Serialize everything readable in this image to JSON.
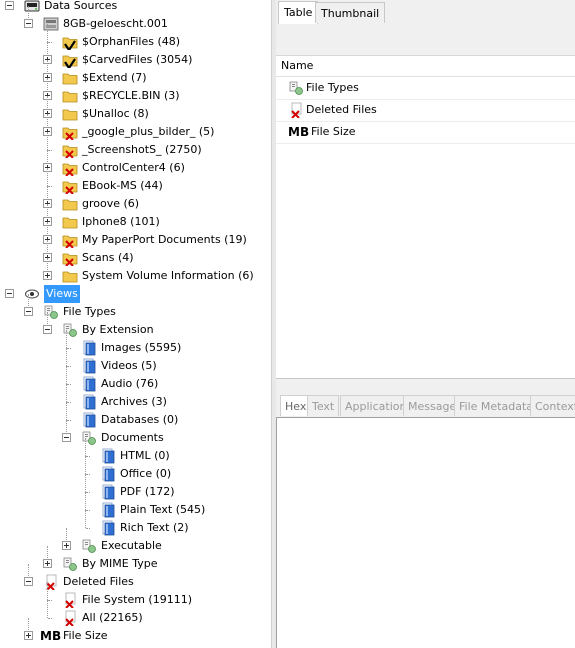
{
  "tree": [
    {
      "label": "Data Sources",
      "level": 0,
      "icon": "drive-icon",
      "toggle": "minus",
      "name": "data-sources"
    },
    {
      "label": "8GB-geloescht.001",
      "level": 1,
      "icon": "disk-image-icon",
      "toggle": "minus",
      "name": "image-8gb"
    },
    {
      "label": "$OrphanFiles (48)",
      "level": 2,
      "icon": "folder-checked-icon",
      "toggle": null,
      "name": "orphan-files"
    },
    {
      "label": "$CarvedFiles (3054)",
      "level": 2,
      "icon": "folder-checked-icon",
      "toggle": "plus",
      "name": "carved-files"
    },
    {
      "label": "$Extend (7)",
      "level": 2,
      "icon": "folder-icon",
      "toggle": "plus",
      "name": "extend"
    },
    {
      "label": "$RECYCLE.BIN (3)",
      "level": 2,
      "icon": "folder-icon",
      "toggle": "plus",
      "name": "recycle-bin"
    },
    {
      "label": "$Unalloc (8)",
      "level": 2,
      "icon": "folder-icon",
      "toggle": "plus",
      "name": "unalloc"
    },
    {
      "label": "_google_plus_bilder_ (5)",
      "level": 2,
      "icon": "folder-deleted-icon",
      "toggle": "plus",
      "name": "google-plus-bilder"
    },
    {
      "label": "_ScreenshotS_ (2750)",
      "level": 2,
      "icon": "folder-deleted-icon",
      "toggle": null,
      "name": "screenshots"
    },
    {
      "label": "ControlCenter4 (6)",
      "level": 2,
      "icon": "folder-deleted-icon",
      "toggle": "plus",
      "name": "controlcenter4"
    },
    {
      "label": "EBook-MS (44)",
      "level": 2,
      "icon": "folder-deleted-icon",
      "toggle": null,
      "name": "ebook-ms"
    },
    {
      "label": "groove (6)",
      "level": 2,
      "icon": "folder-icon",
      "toggle": "plus",
      "name": "groove"
    },
    {
      "label": "Iphone8 (101)",
      "level": 2,
      "icon": "folder-icon",
      "toggle": "plus",
      "name": "iphone8"
    },
    {
      "label": "My PaperPort Documents (19)",
      "level": 2,
      "icon": "folder-deleted-icon",
      "toggle": "plus",
      "name": "paperport"
    },
    {
      "label": "Scans (4)",
      "level": 2,
      "icon": "folder-deleted-icon",
      "toggle": "plus",
      "name": "scans"
    },
    {
      "label": "System Volume Information (6)",
      "level": 2,
      "icon": "folder-icon",
      "toggle": "plus",
      "name": "system-volume-information"
    },
    {
      "label": "Views",
      "level": 0,
      "icon": "eye-icon",
      "toggle": "minus",
      "name": "views",
      "selected": true
    },
    {
      "label": "File Types",
      "level": 1,
      "icon": "file-types-icon",
      "toggle": "minus",
      "name": "file-types"
    },
    {
      "label": "By Extension",
      "level": 2,
      "icon": "file-types-icon",
      "toggle": "minus",
      "name": "by-extension"
    },
    {
      "label": "Images (5595)",
      "level": 3,
      "icon": "document-icon",
      "toggle": null,
      "name": "images"
    },
    {
      "label": "Videos (5)",
      "level": 3,
      "icon": "document-icon",
      "toggle": null,
      "name": "videos"
    },
    {
      "label": "Audio (76)",
      "level": 3,
      "icon": "document-icon",
      "toggle": null,
      "name": "audio"
    },
    {
      "label": "Archives (3)",
      "level": 3,
      "icon": "document-icon",
      "toggle": null,
      "name": "archives"
    },
    {
      "label": "Databases (0)",
      "level": 3,
      "icon": "document-icon",
      "toggle": null,
      "name": "databases"
    },
    {
      "label": "Documents",
      "level": 3,
      "icon": "file-types-icon",
      "toggle": "minus",
      "name": "documents"
    },
    {
      "label": "HTML (0)",
      "level": 4,
      "icon": "document-icon",
      "toggle": null,
      "name": "html"
    },
    {
      "label": "Office (0)",
      "level": 4,
      "icon": "document-icon",
      "toggle": null,
      "name": "office"
    },
    {
      "label": "PDF (172)",
      "level": 4,
      "icon": "document-icon",
      "toggle": null,
      "name": "pdf"
    },
    {
      "label": "Plain Text (545)",
      "level": 4,
      "icon": "document-icon",
      "toggle": null,
      "name": "plain-text"
    },
    {
      "label": "Rich Text (2)",
      "level": 4,
      "icon": "document-icon",
      "toggle": null,
      "name": "rich-text"
    },
    {
      "label": "Executable",
      "level": 3,
      "icon": "file-types-icon",
      "toggle": "plus",
      "name": "executable"
    },
    {
      "label": "By MIME Type",
      "level": 2,
      "icon": "file-types-icon",
      "toggle": "plus",
      "name": "by-mime-type"
    },
    {
      "label": "Deleted Files",
      "level": 1,
      "icon": "deleted-file-icon",
      "toggle": "minus",
      "name": "deleted-files"
    },
    {
      "label": "File System (19111)",
      "level": 2,
      "icon": "deleted-file-icon",
      "toggle": null,
      "name": "file-system"
    },
    {
      "label": "All (22165)",
      "level": 2,
      "icon": "deleted-file-icon",
      "toggle": null,
      "name": "all"
    },
    {
      "label": "File Size",
      "level": 1,
      "icon": "mb-icon",
      "toggle": "plus",
      "name": "file-size"
    }
  ],
  "results": {
    "tabs": [
      "Table",
      "Thumbnail"
    ],
    "active_tab": 0,
    "column_header": "Name",
    "rows": [
      {
        "label": "File Types",
        "icon": "file-types-icon"
      },
      {
        "label": "Deleted Files",
        "icon": "deleted-file-icon"
      },
      {
        "label": "File Size",
        "icon": "mb-icon"
      }
    ]
  },
  "viewer": {
    "tabs": [
      "Hex",
      "Text",
      "Application",
      "Message",
      "File Metadata",
      "Context"
    ],
    "active_tab": 0
  },
  "icons": {
    "mb_text": "MB"
  },
  "colors": {
    "selection": "#3399ff",
    "folder": "#f2c94c",
    "deleted_mark": "#d40000",
    "check_mark": "#000000",
    "document": "#2f6fd1"
  }
}
